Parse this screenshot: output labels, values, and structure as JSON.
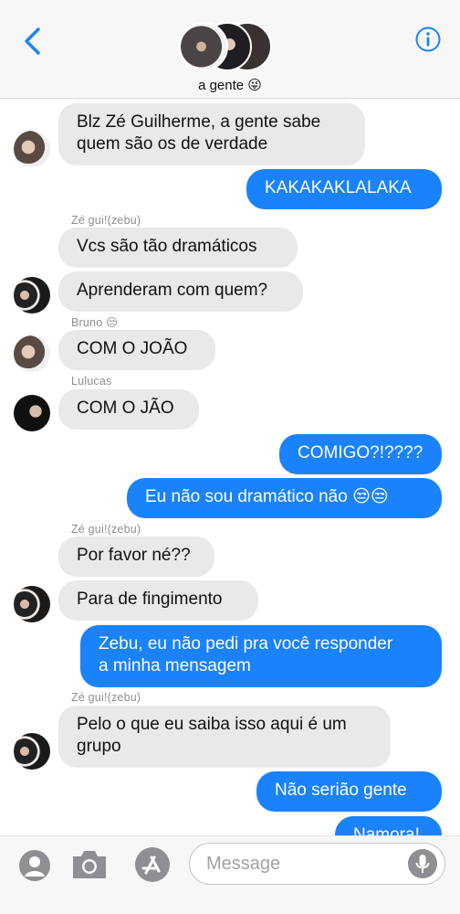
{
  "header": {
    "group_name": "a gente 😜"
  },
  "thread": {
    "messages": [
      {
        "dir": "in",
        "lines": [
          "Blz Zé Guilherme, a gente sabe",
          "quem são os de verdade"
        ]
      },
      {
        "dir": "out",
        "lines": [
          "KAKAKAKLALAKA"
        ]
      },
      {
        "dir": "in",
        "sender": "Zé gui!(zebu)",
        "lines": [
          "Vcs são tão dramáticos"
        ]
      },
      {
        "dir": "in",
        "lines": [
          "Aprenderam com quem?"
        ]
      },
      {
        "dir": "in",
        "sender": "Bruno 😒",
        "lines": [
          "COM O JOÃO"
        ]
      },
      {
        "dir": "in",
        "sender": "Lulucas",
        "lines": [
          "COM O JÃO"
        ]
      },
      {
        "dir": "out",
        "lines": [
          "COMIGO?!????"
        ]
      },
      {
        "dir": "out",
        "lines": [
          "Eu não sou dramático não 😒😒"
        ]
      },
      {
        "dir": "in",
        "sender": "Zé gui!(zebu)",
        "lines": [
          "Por favor né??"
        ]
      },
      {
        "dir": "in",
        "lines": [
          "Para de fingimento"
        ]
      },
      {
        "dir": "out",
        "lines": [
          "Zebu, eu não pedi pra você responder",
          "a minha mensagem"
        ]
      },
      {
        "dir": "in",
        "sender": "Zé gui!(zebu)",
        "lines": [
          "Pelo o que eu saiba isso aqui é um",
          "grupo"
        ]
      },
      {
        "dir": "out",
        "lines": [
          "Não serião gente"
        ]
      },
      {
        "dir": "out",
        "lines": [
          "Namora!"
        ]
      }
    ]
  },
  "compose": {
    "placeholder": "Message"
  },
  "colors": {
    "accent": "#1a82fb",
    "incoming_bubble": "#e9e9eb"
  }
}
